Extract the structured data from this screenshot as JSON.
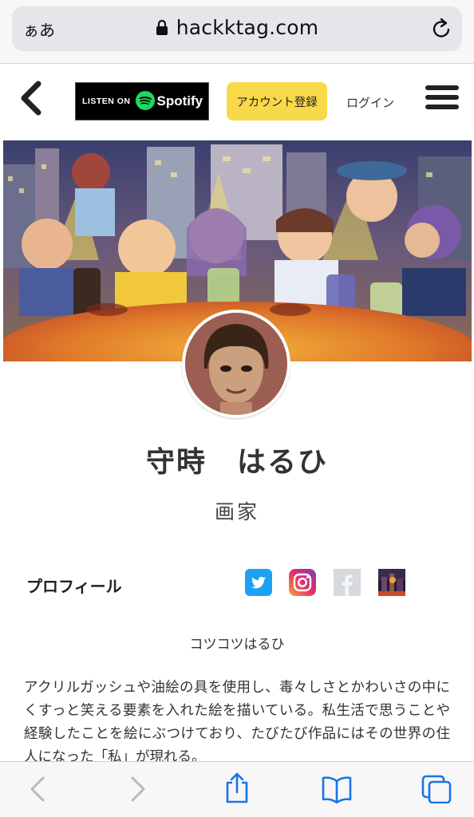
{
  "browser": {
    "aa_label": "ぁあ",
    "url": "hackktag.com",
    "icons": [
      "lock-icon",
      "reload-icon",
      "back-icon",
      "forward-icon",
      "share-icon",
      "bookmarks-icon",
      "tabs-icon"
    ]
  },
  "header": {
    "spotify_listen": "LISTEN ON",
    "spotify_word": "Spotify",
    "register_label": "アカウント登録",
    "login_label": "ログイン"
  },
  "profile": {
    "name": "守時　はるひ",
    "title": "画家",
    "section_label": "プロフィール",
    "tagline": "コツコツはるひ",
    "bio": "アクリルガッシュや油絵の具を使用し、毒々しさとかわいさの中にくすっと笑える要素を入れた絵を描いている。私生活で思うことや経験したことを絵にぶつけており、たびたび作品にはその世界の住人になった「私」が現れる。"
  },
  "colors": {
    "register_bg": "#f8d949",
    "spotify_green": "#1ed760",
    "twitter_blue": "#1da1f2",
    "toolbar_blue": "#1a73e8"
  }
}
